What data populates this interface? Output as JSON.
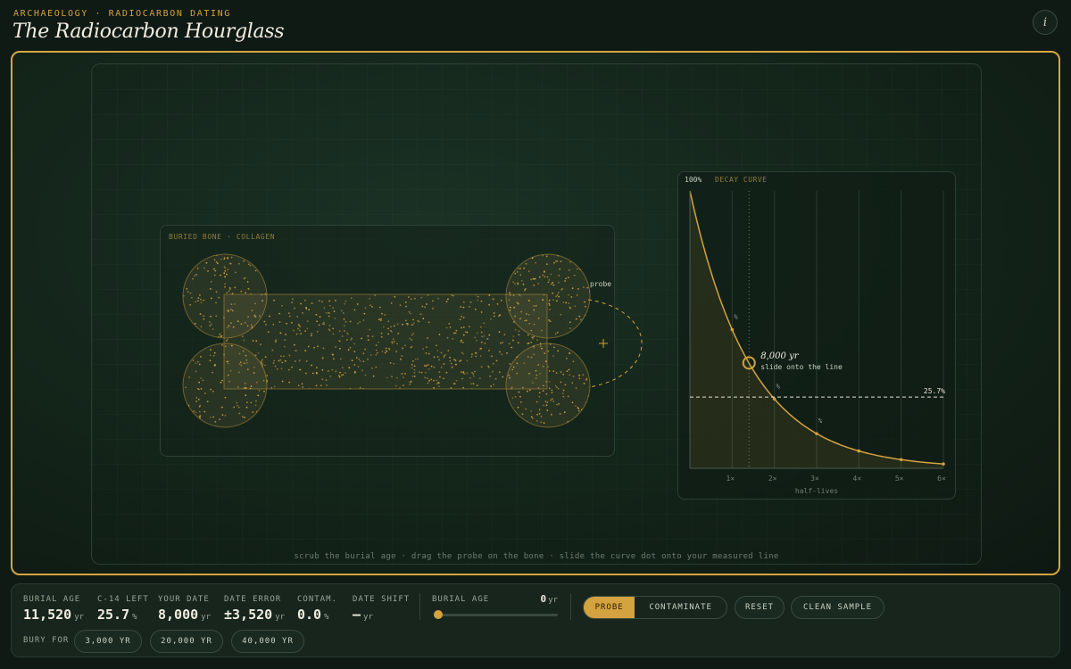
{
  "header": {
    "eyebrow": "ARCHAEOLOGY · RADIOCARBON DATING",
    "title": "The Radiocarbon Hourglass",
    "info_label": "i"
  },
  "bone": {
    "label": "BURIED BONE · COLLAGEN",
    "probe_label": "probe"
  },
  "decay": {
    "label_pct": "100%",
    "label_title": "DECAY CURVE",
    "marker_age": "8,000 yr",
    "marker_hint": "slide onto the line",
    "measured_label": "25.7%",
    "xlabel": "half-lives",
    "ticks": [
      "1×",
      "2×",
      "3×",
      "4×",
      "5×",
      "6×"
    ],
    "point_marker": "%"
  },
  "hint": "scrub the burial age · drag the probe on the bone · slide the curve dot onto your measured line",
  "stats": [
    {
      "label": "BURIAL AGE",
      "value": "11,520",
      "unit": "yr"
    },
    {
      "label": "C-14 LEFT",
      "value": "25.7",
      "unit": "%"
    },
    {
      "label": "YOUR DATE",
      "value": "8,000",
      "unit": "yr"
    },
    {
      "label": "DATE ERROR",
      "value": "±3,520",
      "unit": "yr"
    },
    {
      "label": "CONTAM.",
      "value": "0.0",
      "unit": "%"
    },
    {
      "label": "DATE SHIFT",
      "value": "—",
      "unit": "yr"
    }
  ],
  "slider": {
    "label": "BURIAL AGE",
    "value": "0",
    "unit": "yr",
    "fraction": 0
  },
  "mode": {
    "options": [
      "PROBE",
      "CONTAMINATE"
    ],
    "active": 0
  },
  "buttons": {
    "reset": "RESET",
    "clean": "CLEAN SAMPLE"
  },
  "bury": {
    "label": "BURY FOR",
    "options": [
      "3,000 YR",
      "20,000 YR",
      "40,000 YR"
    ]
  },
  "colors": {
    "accent": "#d4a23f",
    "background": "#0f1a15",
    "text": "#f1ece0"
  },
  "icons": {
    "info": "info-icon",
    "probe": "crosshair-icon",
    "slider": "slider-thumb-icon"
  },
  "chart_data": {
    "type": "line",
    "x": [
      0,
      1,
      2,
      3,
      4,
      5,
      6
    ],
    "series": [
      {
        "values": [
          100,
          50,
          25,
          12.5,
          6.25,
          3.125,
          1.5625
        ]
      }
    ],
    "xlabel": "half-lives",
    "xlim": [
      0,
      6
    ],
    "ylim": [
      0,
      100
    ],
    "measured_level": 25.7,
    "marker": {
      "x": 1.4,
      "y": 38,
      "label": "8,000 yr"
    }
  }
}
